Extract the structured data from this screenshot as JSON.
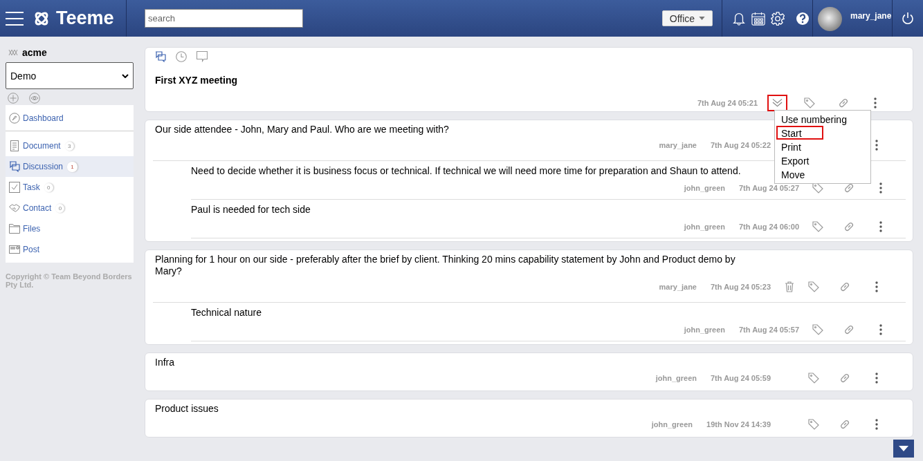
{
  "header": {
    "brand": "Teeme",
    "search": {
      "placeholder": "search"
    },
    "workspace": "Office",
    "user": "mary_jane"
  },
  "sidebar": {
    "org": "acme",
    "project": "Demo",
    "items": [
      {
        "kind": "dashboard",
        "label": "Dashboard",
        "selected": false
      },
      {
        "kind": "document",
        "label": "Document",
        "count": "3",
        "selected": false
      },
      {
        "kind": "discussion",
        "label": "Discussion",
        "count": "1",
        "selected": true
      },
      {
        "kind": "task",
        "label": "Task",
        "count": "0",
        "selected": false
      },
      {
        "kind": "contact",
        "label": "Contact",
        "count": "0",
        "selected": false
      },
      {
        "kind": "files",
        "label": "Files",
        "selected": false
      },
      {
        "kind": "post",
        "label": "Post",
        "selected": false
      }
    ],
    "copyright": "Copyright © Team Beyond Borders Pty Ltd."
  },
  "topic": {
    "views": [
      {
        "kind": "discussion",
        "selected": true
      },
      {
        "kind": "history",
        "selected": false
      },
      {
        "kind": "comments",
        "selected": false
      }
    ],
    "title": "First XYZ meeting",
    "time": "7th Aug 24 05:21",
    "expanded": true,
    "menu": [
      {
        "label": "Use numbering",
        "selected": false
      },
      {
        "label": "Start",
        "selected": true
      },
      {
        "label": "Print",
        "selected": false
      },
      {
        "label": "Export",
        "selected": false
      },
      {
        "label": "Move",
        "selected": false
      }
    ]
  },
  "threads": [
    {
      "text": "Our side attendee - John, Mary and Paul. Who are we meeting with?",
      "author": "mary_jane",
      "time": "7th Aug 24 05:22",
      "deletable": false,
      "replies": [
        {
          "text": "Need to decide whether it is business focus or technical. If technical we will need more time for preparation and Shaun to attend.",
          "author": "john_green",
          "time": "7th Aug 24 05:27"
        },
        {
          "text": "Paul is needed for tech side",
          "author": "john_green",
          "time": "7th Aug 24 06:00"
        }
      ]
    },
    {
      "text": "Planning for 1 hour on our side - preferably after the brief by client. Thinking 20 mins capability statement by John and Product demo by Mary?",
      "author": "mary_jane",
      "time": "7th Aug 24 05:23",
      "deletable": true,
      "replies": [
        {
          "text": "Technical nature",
          "author": "john_green",
          "time": "7th Aug 24 05:57"
        }
      ]
    },
    {
      "text": "Infra",
      "author": "john_green",
      "time": "7th Aug 24 05:59",
      "deletable": false
    },
    {
      "text": "Product issues",
      "author": "john_green",
      "time": "19th Nov 24 14:39",
      "deletable": false
    }
  ]
}
